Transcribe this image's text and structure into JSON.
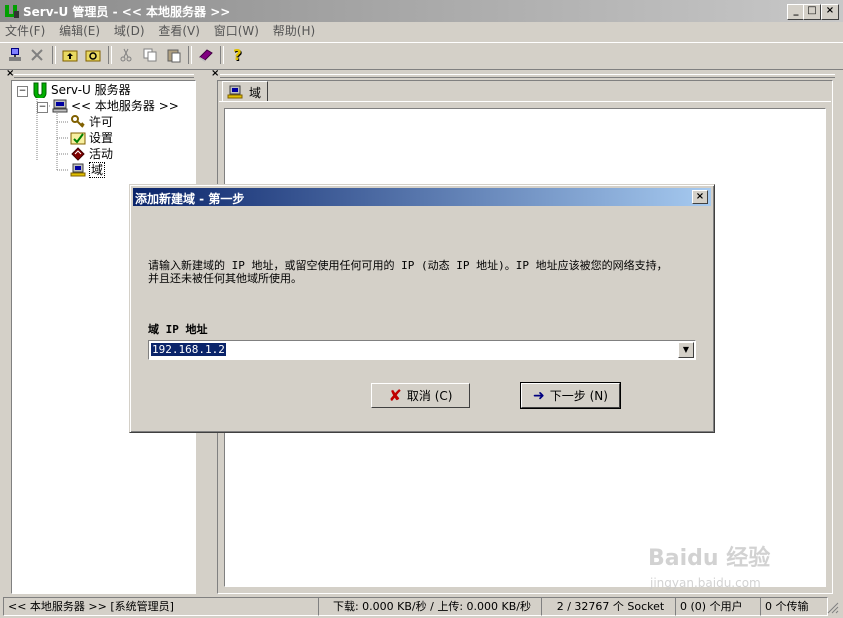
{
  "window": {
    "title": "Serv-U 管理员 - << 本地服务器 >>",
    "min": "_",
    "max": "□",
    "close": "×"
  },
  "menu": [
    "文件(F)",
    "编辑(E)",
    "域(D)",
    "查看(V)",
    "窗口(W)",
    "帮助(H)"
  ],
  "left_pane": {
    "close": "×",
    "tree": {
      "root": "Serv-U 服务器",
      "server": "<< 本地服务器 >>",
      "items": [
        "许可",
        "设置",
        "活动",
        "域"
      ]
    }
  },
  "right_pane": {
    "close": "×",
    "tab": "域"
  },
  "dialog": {
    "title": "添加新建域 - 第一步",
    "close": "×",
    "description_line1": "请输入新建域的 IP 地址，或留空使用任何可用的 IP (动态 IP 地址)。IP 地址应该被您的网络支持，",
    "description_line2": "并且还未被任何其他域所使用。",
    "field_label": "域 IP 地址",
    "ip_value": "192.168.1.2",
    "cancel_label": "取消 (C)",
    "next_label": "下一步 (N)"
  },
  "status": {
    "server": "<< 本地服务器 >>  [系统管理员]",
    "transfer": "下载: 0.000 KB/秒 / 上传: 0.000 KB/秒",
    "sockets": "2 / 32767 个 Socket",
    "users": "0 (0) 个用户",
    "transfers": "0 个传输"
  },
  "watermark": {
    "line1": "Baidu 经验",
    "line2": "jingyan.baidu.com"
  },
  "colors": {
    "dialog_title_start": "#0a246a",
    "dialog_title_end": "#a6caf0",
    "selection": "#0a246a"
  }
}
